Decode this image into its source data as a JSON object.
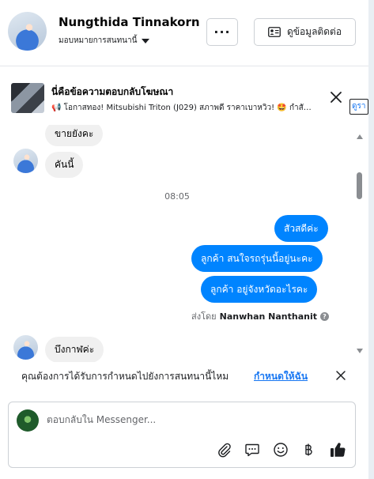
{
  "header": {
    "contact_name": "Nungthida Tinnakorn",
    "assign_label": "มอบหมายการสนทนานี้",
    "more_label": "···",
    "contact_info_label": "ดูข้อมูลติดต่อ"
  },
  "ad_banner": {
    "title": "นี่คือข้อความตอบกลับโฆษณา",
    "text": "📢 โอกาสทอง! Mitsubishi Triton (J029) สภาพดี ราคาเบาหวิว! 🤩 กำสั…",
    "view_label": "ดูรา"
  },
  "messages": {
    "incoming_top_partial": "ขายยังคะ",
    "incoming_1": "คันนี้",
    "timestamp": "08:05",
    "outgoing": [
      "สัวสดีค่ะ",
      "ลูกค้า สนใจรถรุ่นนี้อยู่นะคะ",
      "ลูกค้า  อยู่จังหวัดอะไรคะ"
    ],
    "sent_by_prefix": "ส่งโดย",
    "sent_by_name": "Nanwhan Nanthanit",
    "incoming_2": "บึงกาฬค่ะ"
  },
  "notification": {
    "text": "คุณต้องการได้รับการกำหนดไปยังการสนทนานี้ไหม",
    "link": "กำหนดให้ฉัน"
  },
  "composer": {
    "placeholder": "ตอบกลับใน Messenger..."
  },
  "colors": {
    "outgoing_bubble": "#0084ff",
    "incoming_bubble": "#f0f0f0",
    "link": "#1877f2"
  }
}
